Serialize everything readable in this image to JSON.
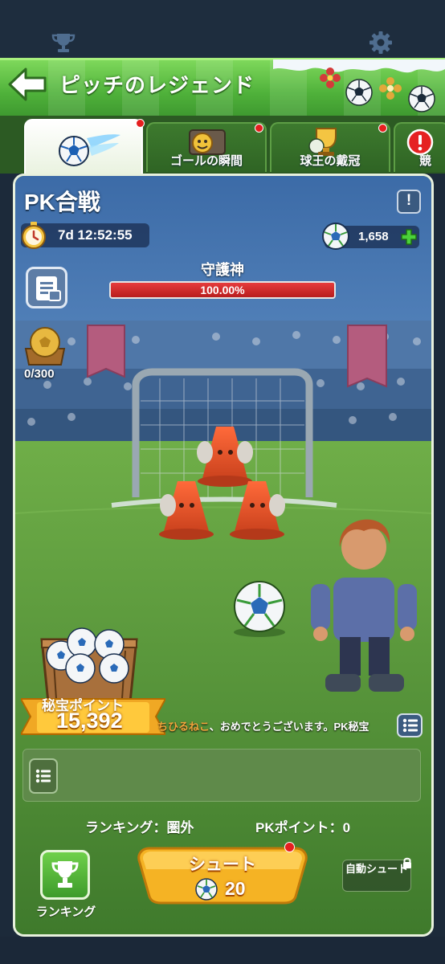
{
  "header": {
    "title": "ピッチのレジェンド",
    "top_icons": [
      "trophy-icon",
      "gear-icon"
    ]
  },
  "tabs": [
    {
      "label": "",
      "icon": "soccer-ball-icon",
      "active": true,
      "badge": true
    },
    {
      "label": "ゴールの瞬間",
      "icon": "goal-moment-icon",
      "active": false,
      "badge": true
    },
    {
      "label": "球王の戴冠",
      "icon": "cup-icon",
      "active": false,
      "badge": true
    },
    {
      "label": "競",
      "icon": "alert-icon",
      "active": false,
      "badge": false
    }
  ],
  "event": {
    "title": "PK合戦",
    "info_label": "!",
    "timer": "7d 12:52:55",
    "currency_value": "1,658",
    "boss_name": "守護神",
    "boss_hp_text": "100.00%",
    "boss_hp_fraction": 1.0,
    "chest_progress": "0/300",
    "treasure_label": "秘宝ポイント",
    "treasure_value": "15,392",
    "ticker_name": "ちひるねこ",
    "ticker_message": "、おめでとうございます。PK秘宝"
  },
  "footer": {
    "ranking_text": "ランキング：圏外",
    "pk_points_text": "PKポイント：0",
    "ranking_button_label": "ランキング",
    "shoot_label": "シュート",
    "shoot_cost": "20",
    "auto_shoot_label": "自動シュート"
  },
  "colors": {
    "header_green": "#5cbf44",
    "panel_border": "#e8f1dd",
    "hp_red": "#d02a2a",
    "shoot_orange": "#f5b324",
    "badge_red": "#e51f1f"
  }
}
